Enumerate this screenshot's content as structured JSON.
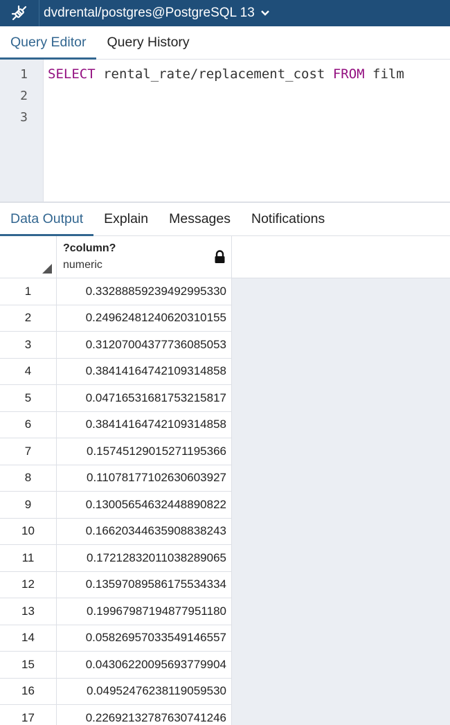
{
  "connection": {
    "title": "dvdrental/postgres@PostgreSQL 13",
    "icon": "disconnected-plug-icon"
  },
  "editor_tabs": [
    {
      "label": "Query Editor",
      "active": true
    },
    {
      "label": "Query History",
      "active": false
    }
  ],
  "editor": {
    "line_numbers": [
      "1",
      "2",
      "3"
    ],
    "line1": {
      "kw1": "SELECT",
      "mid": " rental_rate/replacement_cost ",
      "kw2": "FROM",
      "rest": " film"
    }
  },
  "output_tabs": [
    {
      "label": "Data Output",
      "active": true
    },
    {
      "label": "Explain",
      "active": false
    },
    {
      "label": "Messages",
      "active": false
    },
    {
      "label": "Notifications",
      "active": false
    }
  ],
  "grid": {
    "column": {
      "name": "?column?",
      "type": "numeric",
      "icon": "lock-icon"
    },
    "rows": [
      {
        "n": "1",
        "v": "0.33288859239492995330"
      },
      {
        "n": "2",
        "v": "0.24962481240620310155"
      },
      {
        "n": "3",
        "v": "0.31207004377736085053"
      },
      {
        "n": "4",
        "v": "0.38414164742109314858"
      },
      {
        "n": "5",
        "v": "0.04716531681753215817"
      },
      {
        "n": "6",
        "v": "0.38414164742109314858"
      },
      {
        "n": "7",
        "v": "0.15745129015271195366"
      },
      {
        "n": "8",
        "v": "0.11078177102630603927"
      },
      {
        "n": "9",
        "v": "0.13005654632448890822"
      },
      {
        "n": "10",
        "v": "0.16620344635908838243"
      },
      {
        "n": "11",
        "v": "0.17212832011038289065"
      },
      {
        "n": "12",
        "v": "0.13597089586175534334"
      },
      {
        "n": "13",
        "v": "0.19967987194877951180"
      },
      {
        "n": "14",
        "v": "0.05826957033549146557"
      },
      {
        "n": "15",
        "v": "0.04306220095693779904"
      },
      {
        "n": "16",
        "v": "0.04952476238119059530"
      },
      {
        "n": "17",
        "v": "0.22692132787630741246"
      }
    ]
  }
}
